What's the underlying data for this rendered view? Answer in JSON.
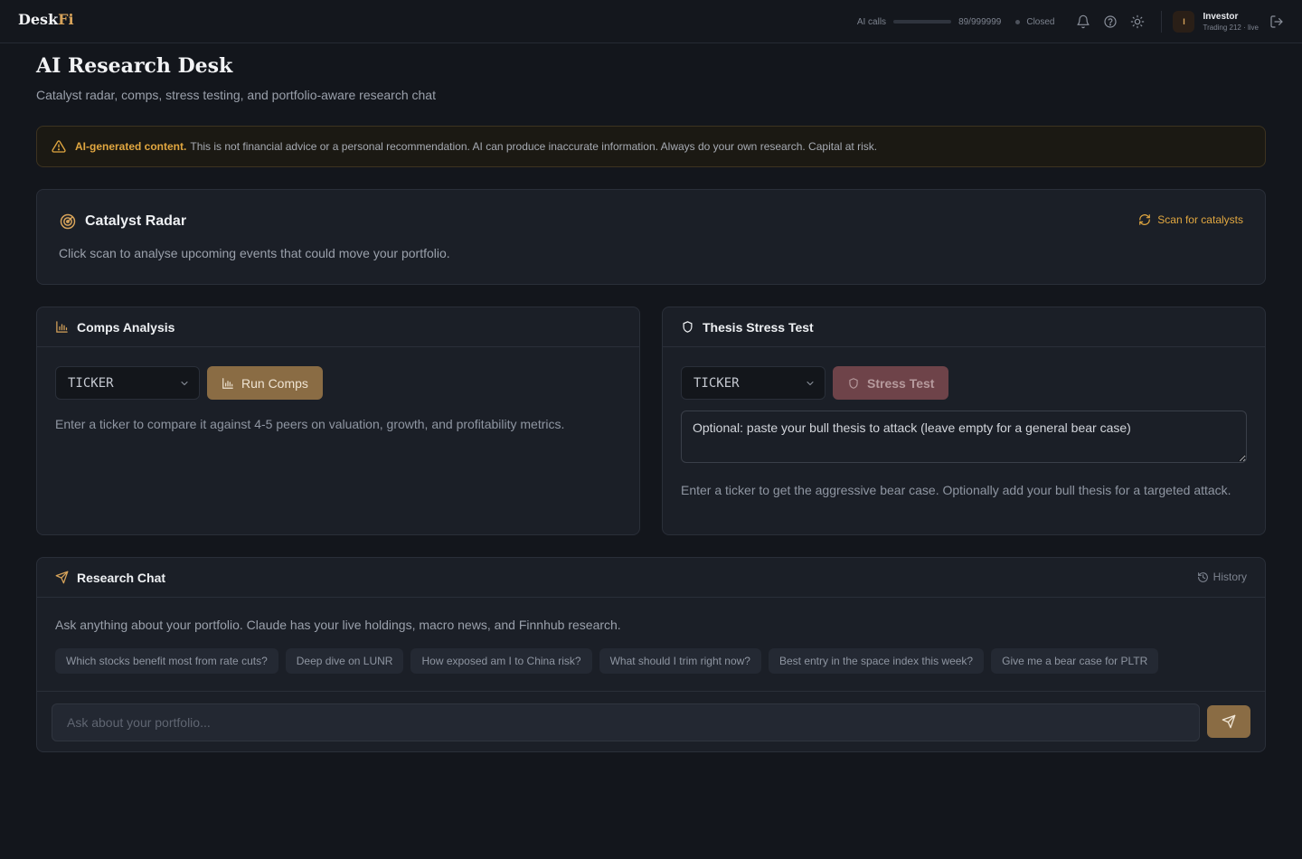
{
  "app": {
    "logo_main": "Desk",
    "logo_accent": "Fi"
  },
  "topbar": {
    "ai_calls_label": "AI calls",
    "ai_calls_count": "89/999999",
    "ai_calls_fraction": 0.0001,
    "market_status": "Closed",
    "icons": [
      "bell-icon",
      "help-icon",
      "sun-icon",
      "logout-icon"
    ],
    "user": {
      "initial": "I",
      "name": "Investor",
      "subtitle": "Trading 212 · live"
    }
  },
  "page": {
    "title": "AI Research Desk",
    "subtitle": "Catalyst radar, comps, stress testing, and portfolio-aware research chat"
  },
  "disclaimer": {
    "label": "AI-generated content.",
    "text": "This is not financial advice or a personal recommendation. AI can produce inaccurate information. Always do your own research. Capital at risk."
  },
  "catalyst_radar": {
    "title": "Catalyst Radar",
    "scan_label": "Scan for catalysts",
    "description": "Click scan to analyse upcoming events that could move your portfolio."
  },
  "comps": {
    "title": "Comps Analysis",
    "ticker_value": "TICKER",
    "button_label": "Run Comps",
    "description": "Enter a ticker to compare it against 4-5 peers on valuation, growth, and profitability metrics."
  },
  "stress_test": {
    "title": "Thesis Stress Test",
    "ticker_value": "TICKER",
    "button_label": "Stress Test",
    "thesis_placeholder": "Optional: paste your bull thesis to attack (leave empty for a general bear case)",
    "description": "Enter a ticker to get the aggressive bear case. Optionally add your bull thesis for a targeted attack."
  },
  "chat": {
    "title": "Research Chat",
    "history_label": "History",
    "intro": "Ask anything about your portfolio. Claude has your live holdings, macro news, and Finnhub research.",
    "suggestions": [
      "Which stocks benefit most from rate cuts?",
      "Deep dive on LUNR",
      "How exposed am I to China risk?",
      "What should I trim right now?",
      "Best entry in the space index this week?",
      "Give me a bear case for PLTR"
    ],
    "input_placeholder": "Ask about your portfolio..."
  },
  "colors": {
    "accent": "#d7a35a",
    "warning": "#e1a740",
    "background": "#13161c",
    "card": "#1b1f27"
  }
}
